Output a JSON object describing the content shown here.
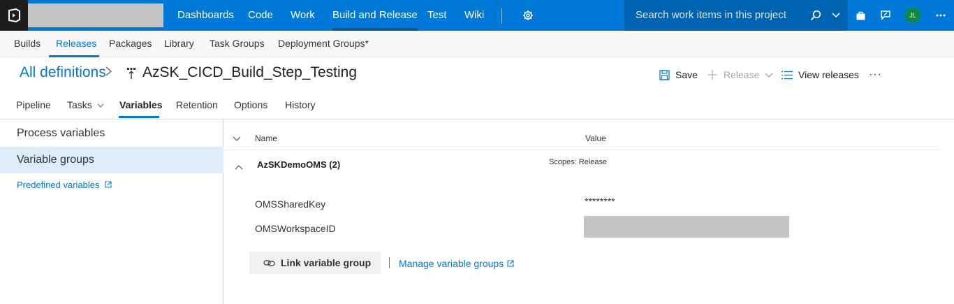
{
  "topnav": {
    "items": [
      "Dashboards",
      "Code",
      "Work",
      "Build and Release",
      "Test",
      "Wiki"
    ],
    "search_placeholder": "Search work items in this project",
    "avatar_initials": "JL",
    "brand_color": "#0078d7"
  },
  "subnav": {
    "items": [
      "Builds",
      "Releases",
      "Packages",
      "Library",
      "Task Groups",
      "Deployment Groups*"
    ],
    "active": "Releases"
  },
  "header": {
    "breadcrumb_root": "All definitions",
    "title": "AzSK_CICD_Build_Step_Testing",
    "save_label": "Save",
    "release_label": "Release",
    "view_releases_label": "View releases",
    "more_label": "···"
  },
  "tabs": [
    "Pipeline",
    "Tasks",
    "Variables",
    "Retention",
    "Options",
    "History"
  ],
  "left_panel": {
    "process_variables": "Process variables",
    "variable_groups": "Variable groups",
    "predefined_link": "Predefined variables"
  },
  "grid": {
    "col_name": "Name",
    "col_value": "Value",
    "group": {
      "name": "AzSKDemoOMS (2)",
      "scope": "Scopes: Release"
    },
    "rows": [
      {
        "name": "OMSSharedKey",
        "value": "********"
      },
      {
        "name": "OMSWorkspaceID",
        "value": ""
      }
    ]
  },
  "actions": {
    "link_group": "Link variable group",
    "manage_groups": "Manage variable groups"
  }
}
